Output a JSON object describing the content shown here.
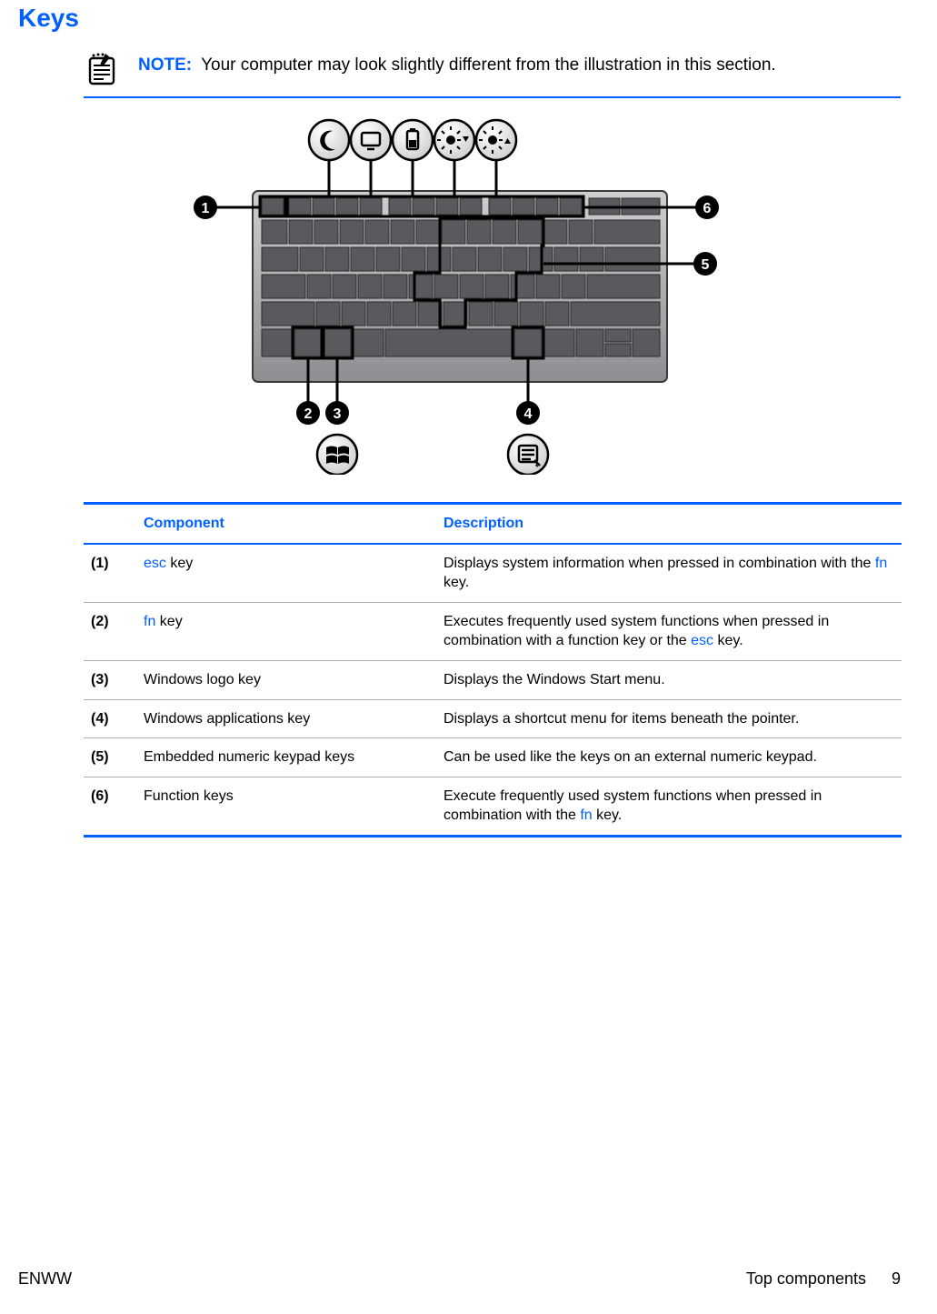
{
  "heading": "Keys",
  "note": {
    "label": "NOTE:",
    "text": "Your computer may look slightly different from the illustration in this section."
  },
  "table": {
    "headers": {
      "component": "Component",
      "description": "Description"
    },
    "rows": [
      {
        "idx": "(1)",
        "component_parts": [
          {
            "text": "esc",
            "link": true
          },
          {
            "text": " key",
            "link": false
          }
        ],
        "description_parts": [
          {
            "text": "Displays system information when pressed in combination with the ",
            "link": false
          },
          {
            "text": "fn",
            "link": true
          },
          {
            "text": " key.",
            "link": false
          }
        ]
      },
      {
        "idx": "(2)",
        "component_parts": [
          {
            "text": "fn",
            "link": true
          },
          {
            "text": " key",
            "link": false
          }
        ],
        "description_parts": [
          {
            "text": "Executes frequently used system functions when pressed in combination with a function key or the ",
            "link": false
          },
          {
            "text": "esc",
            "link": true
          },
          {
            "text": " key.",
            "link": false
          }
        ]
      },
      {
        "idx": "(3)",
        "component_parts": [
          {
            "text": "Windows logo key",
            "link": false
          }
        ],
        "description_parts": [
          {
            "text": "Displays the Windows Start menu.",
            "link": false
          }
        ]
      },
      {
        "idx": "(4)",
        "component_parts": [
          {
            "text": "Windows applications key",
            "link": false
          }
        ],
        "description_parts": [
          {
            "text": "Displays a shortcut menu for items beneath the pointer.",
            "link": false
          }
        ]
      },
      {
        "idx": "(5)",
        "component_parts": [
          {
            "text": "Embedded numeric keypad keys",
            "link": false
          }
        ],
        "description_parts": [
          {
            "text": "Can be used like the keys on an external numeric keypad.",
            "link": false
          }
        ]
      },
      {
        "idx": "(6)",
        "component_parts": [
          {
            "text": "Function keys",
            "link": false
          }
        ],
        "description_parts": [
          {
            "text": "Execute frequently used system functions when pressed in combination with the ",
            "link": false
          },
          {
            "text": "fn",
            "link": true
          },
          {
            "text": " key.",
            "link": false
          }
        ]
      }
    ]
  },
  "footer": {
    "left": "ENWW",
    "section": "Top components",
    "page": "9"
  },
  "callouts": [
    "1",
    "2",
    "3",
    "4",
    "5",
    "6"
  ]
}
